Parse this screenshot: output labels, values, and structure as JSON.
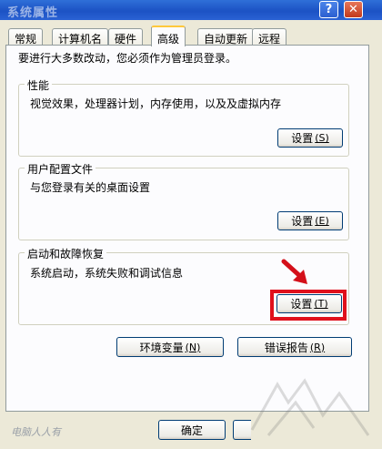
{
  "window": {
    "title": "系统属性",
    "help_glyph": "?",
    "close_glyph": "✕"
  },
  "tabs": [
    {
      "label": "常规"
    },
    {
      "label": "计算机名"
    },
    {
      "label": "硬件"
    },
    {
      "label": "高级"
    },
    {
      "label": "自动更新"
    },
    {
      "label": "远程"
    }
  ],
  "intro": "要进行大多数改动，您必须作为管理员登录。",
  "performance": {
    "title": "性能",
    "description": "视觉效果，处理器计划，内存使用，以及及虚拟内存",
    "button_label": "设置",
    "button_key": "(S)"
  },
  "user_profiles": {
    "title": "用户配置文件",
    "description": "与您登录有关的桌面设置",
    "button_label": "设置",
    "button_key": "(E)"
  },
  "startup_recovery": {
    "title": "启动和故障恢复",
    "description": "系统启动，系统失败和调试信息",
    "button_label": "设置",
    "button_key": "(T)"
  },
  "env_button": {
    "label": "环境变量",
    "key": "(N)"
  },
  "error_button": {
    "label": "错误报告",
    "key": "(R)"
  },
  "ok_button": {
    "label": "确定"
  },
  "footer_logo": "电脑人人有",
  "highlight_color": "#e0101c"
}
